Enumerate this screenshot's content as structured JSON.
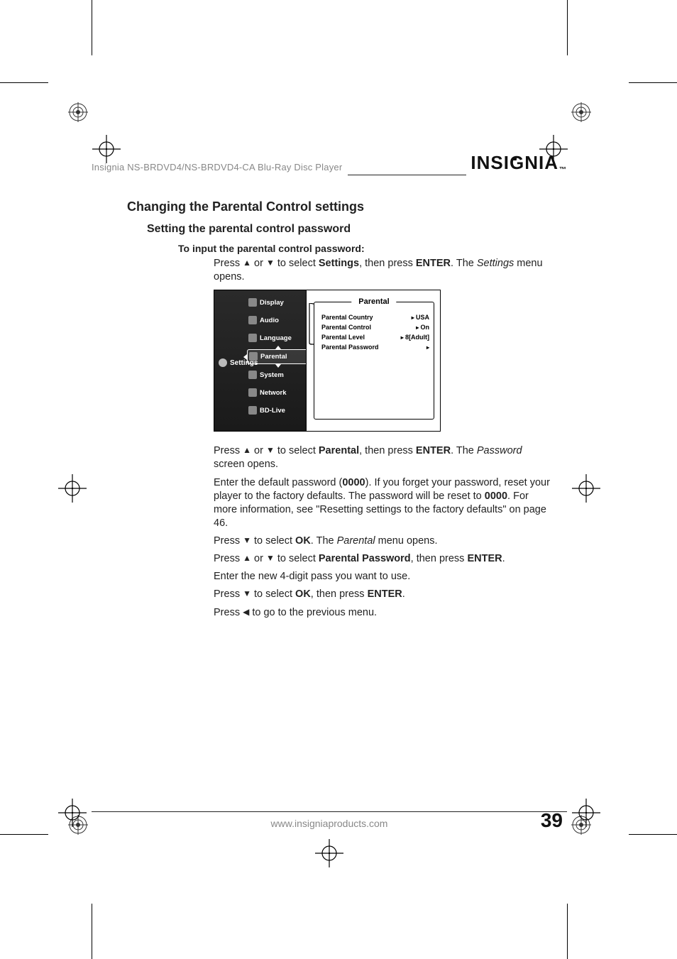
{
  "header": {
    "product_line": "Insignia NS-BRDVD4/NS-BRDVD4-CA Blu-Ray Disc Player",
    "brand": "INSIGNIA",
    "brand_tm": "™"
  },
  "section_title": "Changing the Parental Control settings",
  "subsection_title": "Setting the parental control password",
  "step_heading": "To input the parental control password:",
  "steps": {
    "s1_a": "Press ",
    "s1_b": " or ",
    "s1_c": " to select ",
    "s1_settings": "Settings",
    "s1_d": ", then press ",
    "s1_enter": "ENTER",
    "s1_e": ". The ",
    "s1_settings_italic": "Settings",
    "s1_f": " menu opens.",
    "s2_a": "Press ",
    "s2_b": " or ",
    "s2_c": " to select ",
    "s2_parental": "Parental",
    "s2_d": ", then press ",
    "s2_enter": "ENTER",
    "s2_e": ". The ",
    "s2_password_italic": "Password",
    "s2_f": " screen opens.",
    "s3_a": "Enter the default password (",
    "s3_0000a": "0000",
    "s3_b": "). If you forget your password, reset your player to the factory defaults. The password will be reset to ",
    "s3_0000b": "0000",
    "s3_c": ". For more information, see \"Resetting settings to the factory defaults\" on page 46.",
    "s4_a": "Press ",
    "s4_b": " to select ",
    "s4_ok": "OK",
    "s4_c": ". The ",
    "s4_parental_italic": "Parental",
    "s4_d": " menu opens.",
    "s5_a": "Press ",
    "s5_b": " or ",
    "s5_c": " to select ",
    "s5_pp": "Parental Password",
    "s5_d": ", then press ",
    "s5_enter": "ENTER",
    "s5_e": ".",
    "s6": "Enter the new 4-digit pass you want to use.",
    "s7_a": "Press ",
    "s7_b": " to select ",
    "s7_ok": "OK",
    "s7_c": ", then press ",
    "s7_enter": "ENTER",
    "s7_d": ".",
    "s8_a": "Press ",
    "s8_b": " to go to the previous menu."
  },
  "osd": {
    "left_label": "Settings",
    "menu": [
      "Display",
      "Audio",
      "Language",
      "Parental",
      "System",
      "Network",
      "BD-Live"
    ],
    "panel_title": "Parental",
    "rows": [
      {
        "label": "Parental Country",
        "value": "USA"
      },
      {
        "label": "Parental Control",
        "value": "On"
      },
      {
        "label": "Parental Level",
        "value": "8[Adult]"
      },
      {
        "label": "Parental Password",
        "value": ""
      }
    ]
  },
  "footer": {
    "url": "www.insigniaproducts.com",
    "page": "39"
  },
  "glyphs": {
    "up": "▲",
    "down": "▼",
    "left": "◀"
  }
}
